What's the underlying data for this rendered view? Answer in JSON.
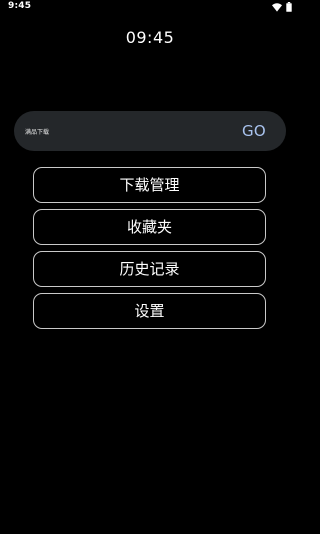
{
  "status_bar": {
    "time": "9:45"
  },
  "clock": {
    "time": "09:45"
  },
  "search": {
    "value": "满品下载",
    "go_label": "GO"
  },
  "menu": {
    "download_label": "下载管理",
    "favorites_label": "收藏夹",
    "history_label": "历史记录",
    "settings_label": "设置"
  },
  "icons": {
    "wifi": "wifi-icon",
    "battery": "battery-icon"
  },
  "colors": {
    "background": "#000000",
    "search_bg": "#24272a",
    "go_accent": "#a9c3ee",
    "button_border": "#c9c9c9"
  }
}
